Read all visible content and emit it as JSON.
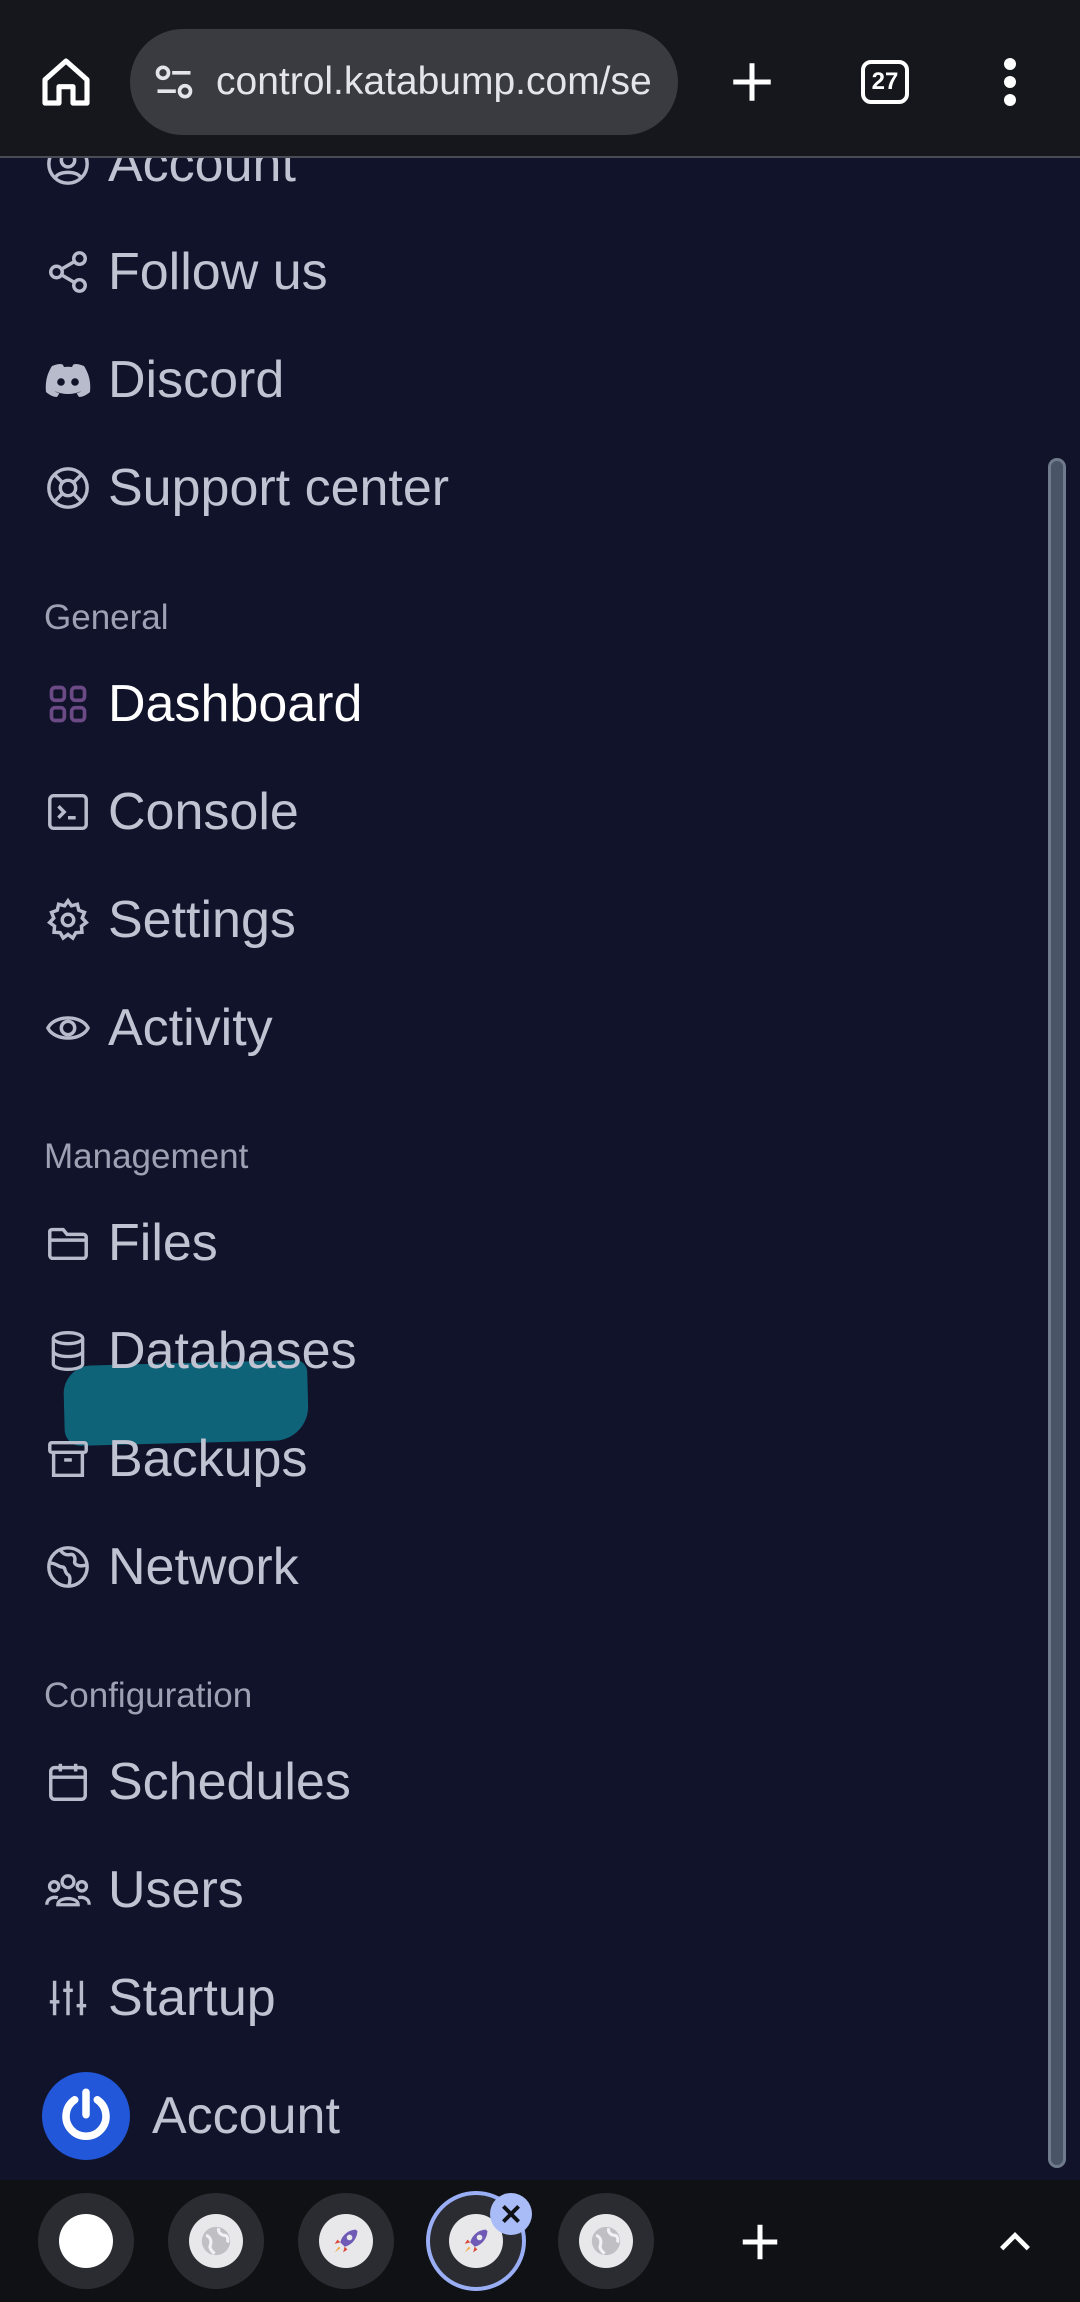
{
  "browser": {
    "url": "control.katabump.com/se",
    "tab_count": "27"
  },
  "sidebar": {
    "top_items": [
      {
        "label": "Account",
        "icon": "user-circle-icon"
      },
      {
        "label": "Follow us",
        "icon": "share-icon"
      },
      {
        "label": "Discord",
        "icon": "discord-icon"
      },
      {
        "label": "Support center",
        "icon": "lifebuoy-icon"
      }
    ],
    "sections": {
      "general": "General",
      "management": "Management",
      "configuration": "Configuration"
    },
    "general_items": [
      {
        "label": "Dashboard",
        "icon": "grid-icon"
      },
      {
        "label": "Console",
        "icon": "terminal-icon"
      },
      {
        "label": "Settings",
        "icon": "gear-icon"
      },
      {
        "label": "Activity",
        "icon": "eye-icon"
      }
    ],
    "management_items": [
      {
        "label": "Files",
        "icon": "folder-icon"
      },
      {
        "label": "Databases",
        "icon": "database-icon"
      },
      {
        "label": "Backups",
        "icon": "archive-icon"
      },
      {
        "label": "Network",
        "icon": "globe-icon"
      }
    ],
    "configuration_items": [
      {
        "label": "Schedules",
        "icon": "calendar-icon"
      },
      {
        "label": "Users",
        "icon": "users-icon"
      },
      {
        "label": "Startup",
        "icon": "sliders-icon"
      }
    ],
    "account_footer": {
      "label": "Account"
    }
  },
  "colors": {
    "background": "#11132a",
    "text": "#c0c3d2",
    "active_text": "#ffffff",
    "highlight": "#0f6a80",
    "avatar": "#2157d8"
  }
}
